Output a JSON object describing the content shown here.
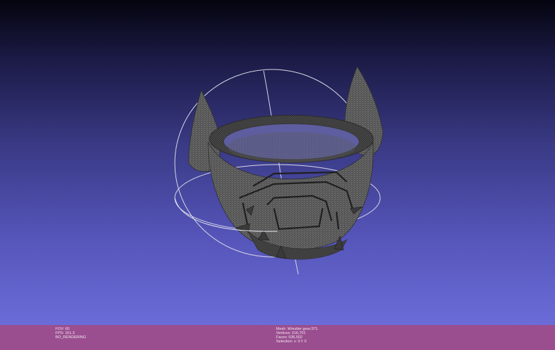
{
  "viewport": {
    "background_top": "#04040f",
    "background_bottom": "#6b6cd8",
    "mesh_color": "#5a5a5a",
    "trackball_color": "#d9d9e6",
    "rendered_object": "3d-mesh-wireframe"
  },
  "status_bar": {
    "background": "#9a4e8f",
    "left": {
      "fov": "FOV: 60",
      "fps": "FPS:   161.3",
      "renderer": "BO_RENDERING"
    },
    "right": {
      "mesh": "Mesh: Wrestler gear.STL",
      "vertices": "Vertices: 316,701",
      "faces": "Faces: 636,502",
      "selection": "Selection: v: 0 f: 0"
    }
  }
}
